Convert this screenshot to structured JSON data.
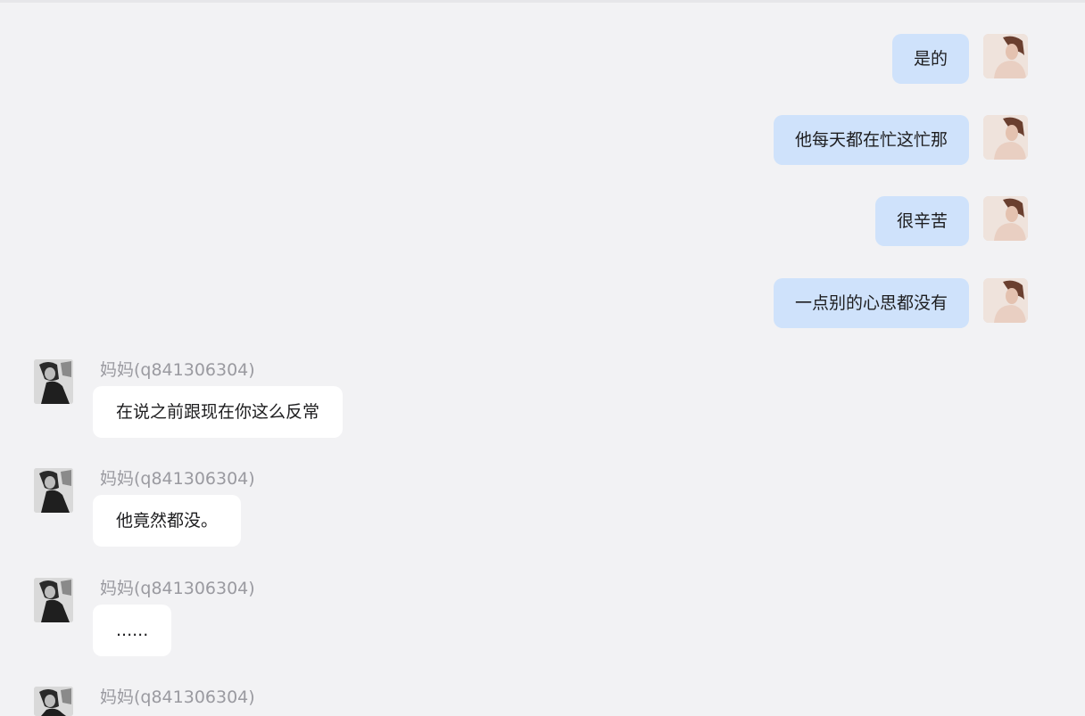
{
  "sent_messages": [
    {
      "text": "是的"
    },
    {
      "text": "他每天都在忙这忙那"
    },
    {
      "text": "很辛苦"
    },
    {
      "text": "一点别的心思都没有"
    }
  ],
  "received_messages": [
    {
      "sender": "妈妈(q841306304)",
      "text": "在说之前跟现在你这么反常"
    },
    {
      "sender": "妈妈(q841306304)",
      "text": "他竟然都没。"
    },
    {
      "sender": "妈妈(q841306304)",
      "text": "......"
    },
    {
      "sender": "妈妈(q841306304)",
      "text": ""
    }
  ],
  "colors": {
    "background": "#f2f2f4",
    "sent_bubble": "#cfe2fb",
    "received_bubble": "#ffffff",
    "sender_name": "#9a9aa0"
  }
}
